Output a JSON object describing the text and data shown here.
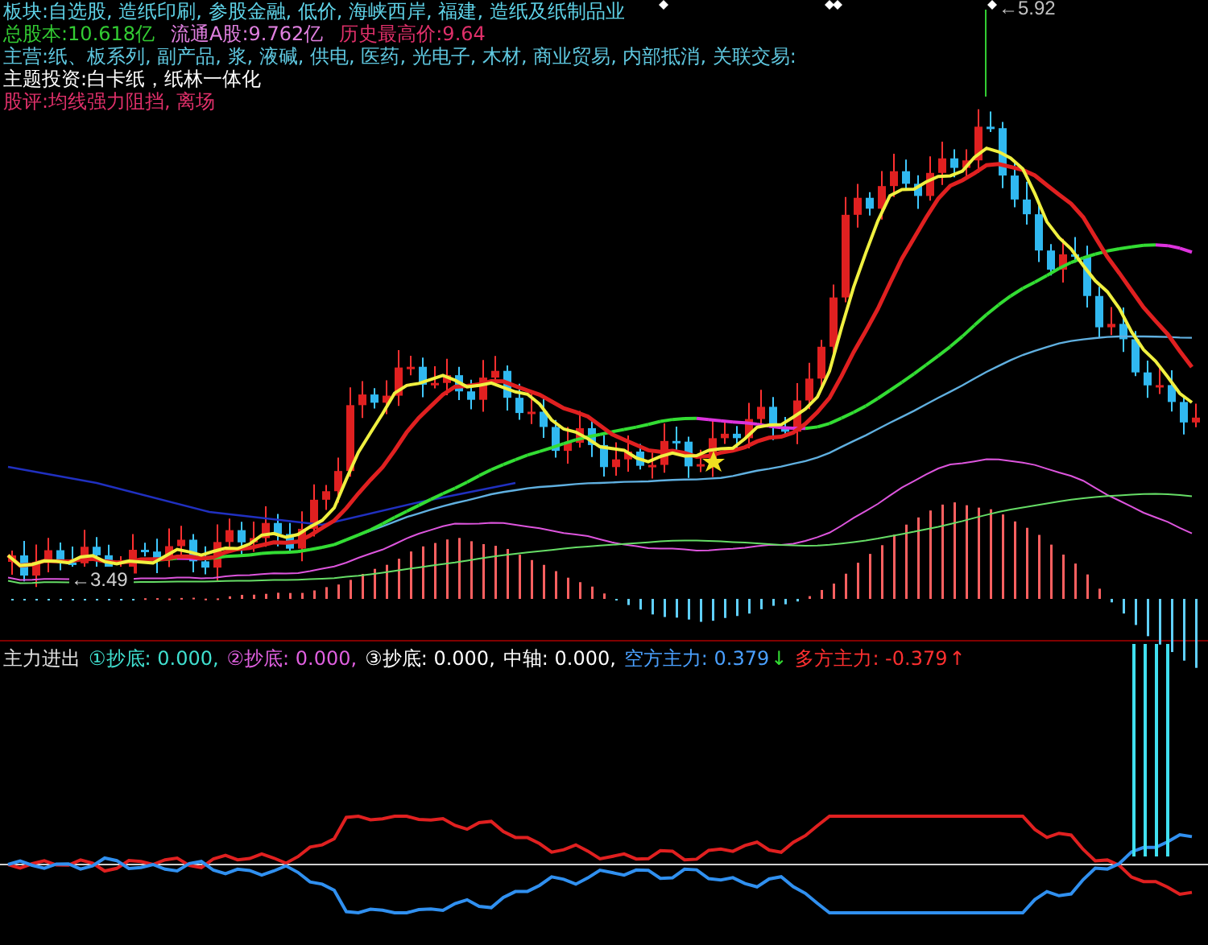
{
  "info_lines": [
    {
      "segments": [
        {
          "text": "板块:自选股, 造纸印刷, 参股金融, 低价, 海峡西岸, 福建, 造纸及纸制品业",
          "color": "#5fd3e8"
        }
      ]
    },
    {
      "segments": [
        {
          "text": "总股本:10.618亿",
          "color": "#33cc33"
        },
        {
          "text": "流通A股:9.762亿",
          "color": "#e080e0"
        },
        {
          "text": "历史最高价:9.64",
          "color": "#e0306a"
        }
      ]
    },
    {
      "segments": [
        {
          "text": "主营:纸、板系列, 副产品, 浆, 液碱, 供电, 医药, 光电子, 木材, 商业贸易, 内部抵消, 关联交易:",
          "color": "#5fc8e0"
        }
      ]
    },
    {
      "segments": [
        {
          "text": "主题投资:白卡纸，纸林一体化",
          "color": "#ffffff"
        }
      ]
    },
    {
      "segments": [
        {
          "text": "股评:均线强力阻挡, 离场",
          "color": "#e0306a"
        }
      ]
    }
  ],
  "high_label": "←5.92",
  "low_label": "←3.49",
  "indicator": {
    "title": "主力进出",
    "items": [
      {
        "text": "①抄底: 0.000,",
        "color": "#40e0d0"
      },
      {
        "text": "②抄底: 0.000,",
        "color": "#e060e0"
      },
      {
        "text": "③抄底: 0.000,",
        "color": "#ffffff"
      },
      {
        "text": "中轴: 0.000,",
        "color": "#ffffff"
      },
      {
        "text": "空方主力: 0.379",
        "color": "#4aa0ff",
        "arrow": {
          "text": "↓",
          "color": "#33dd33"
        }
      },
      {
        "text": "多方主力: -0.379",
        "color": "#ff3030",
        "arrow": {
          "text": "↑",
          "color": "#ff3030"
        }
      }
    ]
  }
}
